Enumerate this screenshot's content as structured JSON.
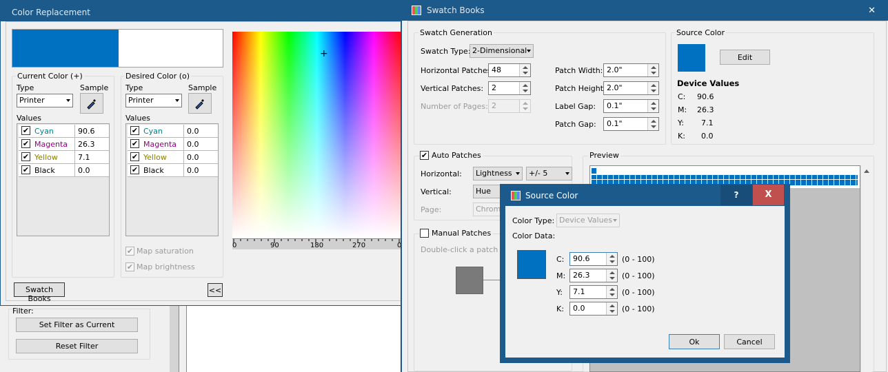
{
  "colors": {
    "title_bar": "#1c5a8c",
    "swatch": "#0070c0",
    "cyan_text": "#007a8a",
    "magenta_text": "#8a0080",
    "yellow_text": "#8a8000",
    "close_red": "#c0504d"
  },
  "color_replacement": {
    "title": "Color Replacement",
    "current": {
      "group_label": "Current Color (+)",
      "type_label": "Type",
      "sample_label": "Sample",
      "type_value": "Printer",
      "values_label": "Values",
      "rows": [
        {
          "name": "Cyan",
          "value": "90.6",
          "check": "✔"
        },
        {
          "name": "Magenta",
          "value": "26.3",
          "check": "✔"
        },
        {
          "name": "Yellow",
          "value": "7.1",
          "check": "✔"
        },
        {
          "name": "Black",
          "value": "0.0",
          "check": "✔"
        }
      ]
    },
    "desired": {
      "group_label": "Desired Color (o)",
      "type_label": "Type",
      "sample_label": "Sample",
      "type_value": "Printer",
      "values_label": "Values",
      "rows": [
        {
          "name": "Cyan",
          "value": "0.0",
          "check": "✔"
        },
        {
          "name": "Magenta",
          "value": "0.0",
          "check": "✔"
        },
        {
          "name": "Yellow",
          "value": "0.0",
          "check": "✔"
        },
        {
          "name": "Black",
          "value": "0.0",
          "check": "✔"
        }
      ]
    },
    "map_saturation": "Map saturation",
    "map_brightness": "Map brightness",
    "hue_ticks": [
      "0",
      "90",
      "180",
      "270",
      "0"
    ],
    "crosshair": "+",
    "swatch_books_button": "Swatch Books",
    "collapse_button": "<<"
  },
  "background_panel": {
    "filter_label": "Filter:",
    "set_filter_button": "Set Filter as Current",
    "reset_filter_button": "Reset Filter"
  },
  "swatch_books": {
    "title": "Swatch Books",
    "close": "✕",
    "swatch_generation": {
      "label": "Swatch Generation",
      "swatch_type_label": "Swatch Type:",
      "swatch_type_value": "2-Dimensional",
      "horizontal_patches_label": "Horizontal Patches:",
      "horizontal_patches_value": "48",
      "vertical_patches_label": "Vertical Patches:",
      "vertical_patches_value": "2",
      "number_of_pages_label": "Number of Pages:",
      "number_of_pages_value": "2",
      "patch_width_label": "Patch Width:",
      "patch_width_value": "2.0\"",
      "patch_height_label": "Patch Height:",
      "patch_height_value": "2.0\"",
      "label_gap_label": "Label Gap:",
      "label_gap_value": "0.1\"",
      "patch_gap_label": "Patch Gap:",
      "patch_gap_value": "0.1\""
    },
    "source_color": {
      "label": "Source Color",
      "edit_button": "Edit",
      "device_values_label": "Device Values",
      "values": [
        {
          "k": "C:",
          "v": "90.6"
        },
        {
          "k": "M:",
          "v": "26.3"
        },
        {
          "k": "Y:",
          "v": "7.1"
        },
        {
          "k": "K:",
          "v": "0.0"
        }
      ]
    },
    "auto_patches": {
      "label": "Auto Patches",
      "check": "✔",
      "horizontal_label": "Horizontal:",
      "horizontal_value": "Lightness",
      "horizontal_step": "+/- 5",
      "vertical_label": "Vertical:",
      "vertical_value": "Hue",
      "page_label": "Page:",
      "page_value": "Chroma"
    },
    "manual_patches": {
      "label": "Manual Patches",
      "hint": "Double-click a patch to e"
    },
    "preview_label": "Preview"
  },
  "source_color_dialog": {
    "title": "Source Color",
    "help": "?",
    "close": "X",
    "color_type_label": "Color Type:",
    "color_type_value": "Device Values",
    "color_data_label": "Color Data:",
    "fields": [
      {
        "k": "C:",
        "v": "90.6",
        "range": "(0 - 100)"
      },
      {
        "k": "M:",
        "v": "26.3",
        "range": "(0 - 100)"
      },
      {
        "k": "Y:",
        "v": "7.1",
        "range": "(0 - 100)"
      },
      {
        "k": "K:",
        "v": "0.0",
        "range": "(0 - 100)"
      }
    ],
    "ok_button": "Ok",
    "cancel_button": "Cancel"
  }
}
